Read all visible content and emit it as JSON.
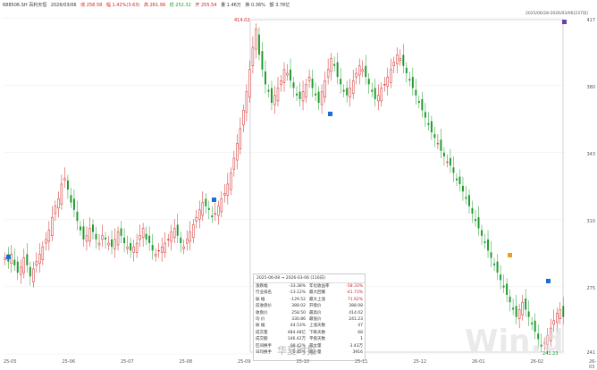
{
  "topbar": {
    "code": "688506.SH 百利天恒",
    "date": "2026/03/06",
    "close": "收 258.58",
    "change": "幅 1.42%(3.63)",
    "high": "高 261.99",
    "low": "低 252.32",
    "open": "开 255.54",
    "vol": "量 1.46万",
    "turnover": "换 0.36%",
    "amount": "额 3.78亿",
    "close2": "低 258.58"
  },
  "range_label": "2025/06/28-2026/03/06(237日)",
  "price_labels": {
    "peak": "414.02",
    "trough": "241.23"
  },
  "y_ticks": [
    "417",
    "380",
    "343",
    "310",
    "275",
    "241"
  ],
  "x_labels": [
    "25-05",
    "25-06",
    "25-07",
    "25-08",
    "25-09",
    "25-10",
    "25-11",
    "25-12",
    "26-01",
    "26-02",
    "26-03"
  ],
  "stats": {
    "header_from": "2025-06-08",
    "header_to": "2026-03-06",
    "header_days": "116日",
    "rows": [
      [
        "涨跌幅",
        "-33.38%",
        "年化收益率",
        "-58.33%"
      ],
      [
        "行业排名",
        "-13.12%",
        "最大回撤",
        "-41.73%"
      ],
      [
        "振 幅",
        "-129.52",
        "最大上涨",
        "71.62%"
      ],
      [
        "前收盘价",
        "388.02",
        "开盘价",
        "388.08"
      ],
      [
        "收盘价",
        "258.50",
        "最高价",
        "414.02"
      ],
      [
        "均 价",
        "330.86",
        "最低价",
        "241.23"
      ],
      [
        "振 幅",
        "44.53%",
        "上涨天数",
        "47"
      ],
      [
        "成交量",
        "484.48亿",
        "下跌天数",
        "68"
      ],
      [
        "成交额",
        "146.42万",
        "平盘天数",
        "1"
      ],
      [
        "区间换手",
        "98.42%",
        "最大量",
        "3.43万"
      ],
      [
        "日均换手",
        "0.85%",
        "最小量",
        "3916"
      ]
    ]
  },
  "watermark": "华夏时报",
  "logo_text": "Win.d",
  "colors": {
    "up": "#d4201f",
    "down": "#1a9a2a"
  },
  "chart_data": {
    "type": "candlestick",
    "ylim": [
      238,
      420
    ],
    "close": [
      290,
      288,
      292,
      286,
      282,
      285,
      290,
      286,
      280,
      284,
      288,
      292,
      296,
      300,
      305,
      312,
      318,
      322,
      330,
      333,
      327,
      320,
      316,
      310,
      305,
      300,
      302,
      306,
      304,
      300,
      298,
      302,
      300,
      298,
      296,
      300,
      304,
      302,
      298,
      296,
      294,
      296,
      298,
      302,
      306,
      300,
      298,
      294,
      292,
      294,
      296,
      298,
      300,
      304,
      306,
      302,
      298,
      296,
      300,
      304,
      308,
      312,
      316,
      320,
      318,
      316,
      312,
      314,
      318,
      322,
      325,
      330,
      336,
      344,
      352,
      360,
      370,
      380,
      392,
      404,
      414,
      400,
      392,
      384,
      380,
      374,
      378,
      382,
      386,
      392,
      390,
      386,
      382,
      378,
      376,
      380,
      384,
      388,
      382,
      378,
      374,
      380,
      386,
      392,
      398,
      394,
      388,
      384,
      380,
      378,
      382,
      386,
      390,
      394,
      392,
      388,
      384,
      380,
      376,
      378,
      382,
      384,
      388,
      392,
      396,
      400,
      398,
      394,
      390,
      386,
      382,
      378,
      374,
      370,
      366,
      362,
      358,
      355,
      352,
      348,
      345,
      342,
      340,
      336,
      332,
      330,
      326,
      322,
      318,
      314,
      310,
      306,
      302,
      298,
      294,
      290,
      286,
      282,
      278,
      274,
      270,
      266,
      262,
      258,
      262,
      266,
      262,
      258,
      254,
      250,
      246,
      242,
      244,
      248,
      252,
      256,
      260,
      262,
      258
    ],
    "ylabel": ""
  }
}
